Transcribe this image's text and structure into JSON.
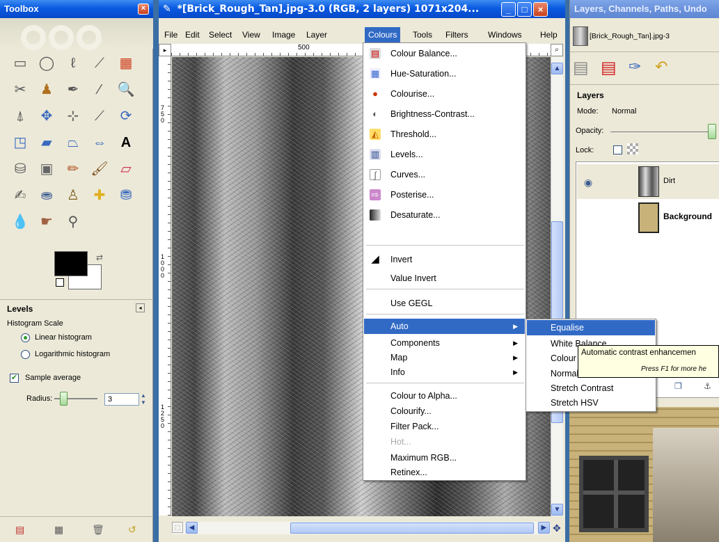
{
  "toolbox": {
    "title": "Toolbox",
    "close_glyph": "×",
    "levels": {
      "title": "Levels",
      "histogram_scale_label": "Histogram Scale",
      "linear_label": "Linear histogram",
      "log_label": "Logarithmic histogram",
      "sample_average_label": "Sample average",
      "radius_label": "Radius:",
      "radius_value": "3"
    }
  },
  "image_window": {
    "title": "*[Brick_Rough_Tan].jpg-3.0 (RGB, 2 layers) 1071x204...",
    "menus": [
      "File",
      "Edit",
      "Select",
      "View",
      "Image",
      "Layer",
      "Colours",
      "Tools",
      "Filters",
      "Windows",
      "Help"
    ],
    "active_menu": "Colours",
    "ruler_h_label": "500",
    "ruler_v_labels": [
      "750",
      "1000",
      "1250"
    ]
  },
  "colours_menu": {
    "items": [
      {
        "label": "Colour Balance...",
        "icon": "colour-balance-icon"
      },
      {
        "label": "Hue-Saturation...",
        "icon": "hue-saturation-icon"
      },
      {
        "label": "Colourise...",
        "icon": "colourise-icon"
      },
      {
        "label": "Brightness-Contrast...",
        "icon": "brightness-contrast-icon"
      },
      {
        "label": "Threshold...",
        "icon": "threshold-icon"
      },
      {
        "label": "Levels...",
        "icon": "levels-icon"
      },
      {
        "label": "Curves...",
        "icon": "curves-icon"
      },
      {
        "label": "Posterise...",
        "icon": "posterise-icon"
      },
      {
        "label": "Desaturate...",
        "icon": "desaturate-icon"
      },
      {
        "label": "Invert",
        "icon": "invert-icon"
      },
      {
        "label": "Value Invert"
      },
      {
        "label": "Use GEGL"
      },
      {
        "label": "Auto"
      },
      {
        "label": "Components"
      },
      {
        "label": "Map"
      },
      {
        "label": "Info"
      },
      {
        "label": "Colour to Alpha..."
      },
      {
        "label": "Colourify..."
      },
      {
        "label": "Filter Pack..."
      },
      {
        "label": "Hot..."
      },
      {
        "label": "Maximum RGB..."
      },
      {
        "label": "Retinex..."
      }
    ],
    "highlighted": "Auto"
  },
  "auto_menu": {
    "items": [
      "Equalise",
      "White Balance",
      "Colour",
      "Normal",
      "Stretch Contrast",
      "Stretch HSV"
    ],
    "highlighted": "Equalise"
  },
  "tooltip": {
    "text": "Automatic contrast enhancemen",
    "hint": "Press F1 for more he"
  },
  "dock": {
    "title": "Layers, Channels, Paths, Undo",
    "image_name": "[Brick_Rough_Tan].jpg-3",
    "layers_title": "Layers",
    "mode_label": "Mode:",
    "mode_value": "Normal",
    "opacity_label": "Opacity:",
    "lock_label": "Lock:",
    "layers": [
      {
        "name": "Dirt",
        "visible": true
      },
      {
        "name": "Background",
        "visible": false
      }
    ]
  },
  "colors": {
    "menu_highlight": "#316ac5",
    "titlebar": "#0a5ae0",
    "panel": "#ece9d8"
  }
}
